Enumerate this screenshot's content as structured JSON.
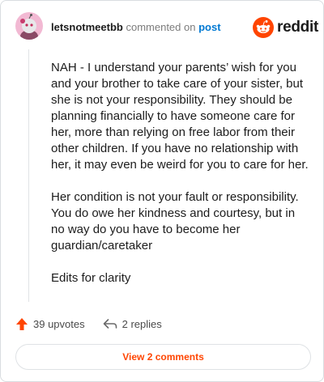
{
  "header": {
    "username": "letsnotmeetbb",
    "verb": "commented on",
    "post_link": "post",
    "brand": "reddit"
  },
  "comment": {
    "paragraphs": [
      "NAH - I understand your parents’ wish for you and your brother to take care of your sister, but she is not your responsibility. They should be planning financially to have someone care for her, more than relying on free labor from their other children. If you have no relationship with her, it may even be weird for you to care for her.",
      "Her condition is not your fault or responsibility. You do owe her kindness and courtesy, but in no way do you have to become her guardian/caretaker",
      "Edits for clarity"
    ]
  },
  "actions": {
    "upvotes_label": "39 upvotes",
    "replies_label": "2 replies"
  },
  "footer": {
    "view_comments_label": "View 2 comments"
  },
  "colors": {
    "brand_orange": "#ff4500",
    "link_blue": "#0079d3",
    "avatar_pink": "#f2b9d3"
  },
  "icons": [
    "avatar",
    "reddit-logo-icon",
    "upvote-arrow-icon",
    "reply-icon"
  ]
}
